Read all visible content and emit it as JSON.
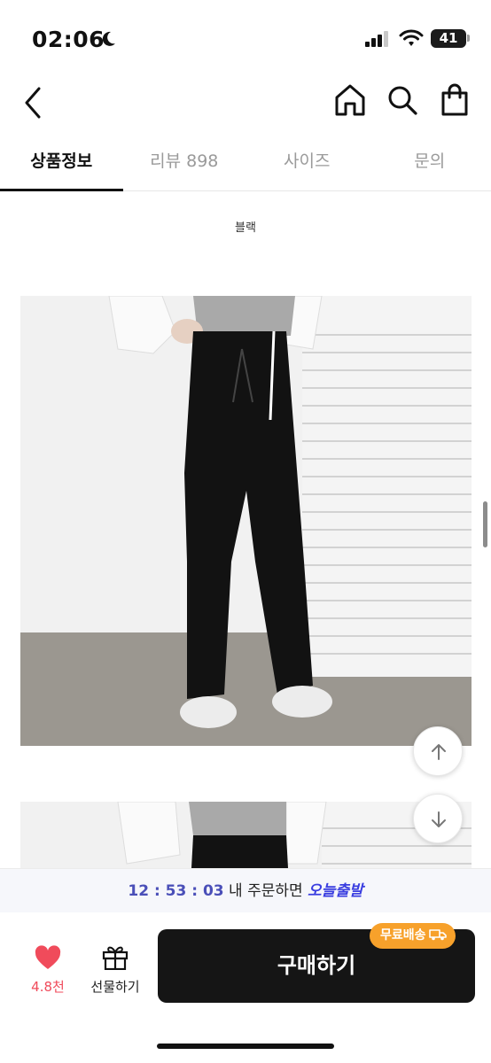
{
  "status_bar": {
    "time": "02:06",
    "battery": "41"
  },
  "header": {
    "back_icon": "chevron-left-icon",
    "home_icon": "home-icon",
    "search_icon": "search-icon",
    "bag_icon": "shopping-bag-icon"
  },
  "tabs": [
    {
      "label": "상품정보",
      "active": true
    },
    {
      "label": "리뷰 898",
      "active": false
    },
    {
      "label": "사이즈",
      "active": false
    },
    {
      "label": "문의",
      "active": false
    }
  ],
  "content": {
    "color_label": "블랙",
    "photos": [
      "product-photo-black-flare-pants",
      "product-photo-second"
    ]
  },
  "floating": {
    "up_icon": "arrow-up-icon",
    "down_icon": "arrow-down-icon"
  },
  "shipping_banner": {
    "timer": "12 : 53 : 03",
    "middle": " 내 주문하면 ",
    "today": "오늘출발"
  },
  "bottom_bar": {
    "like_count": "4.8천",
    "gift_label": "선물하기",
    "buy_label": "구매하기",
    "free_shipping": "무료배송"
  },
  "colors": {
    "accent": "#3a3ee0",
    "heart": "#f04b5b",
    "badge": "#f7a12b",
    "buy_button": "#151515"
  }
}
